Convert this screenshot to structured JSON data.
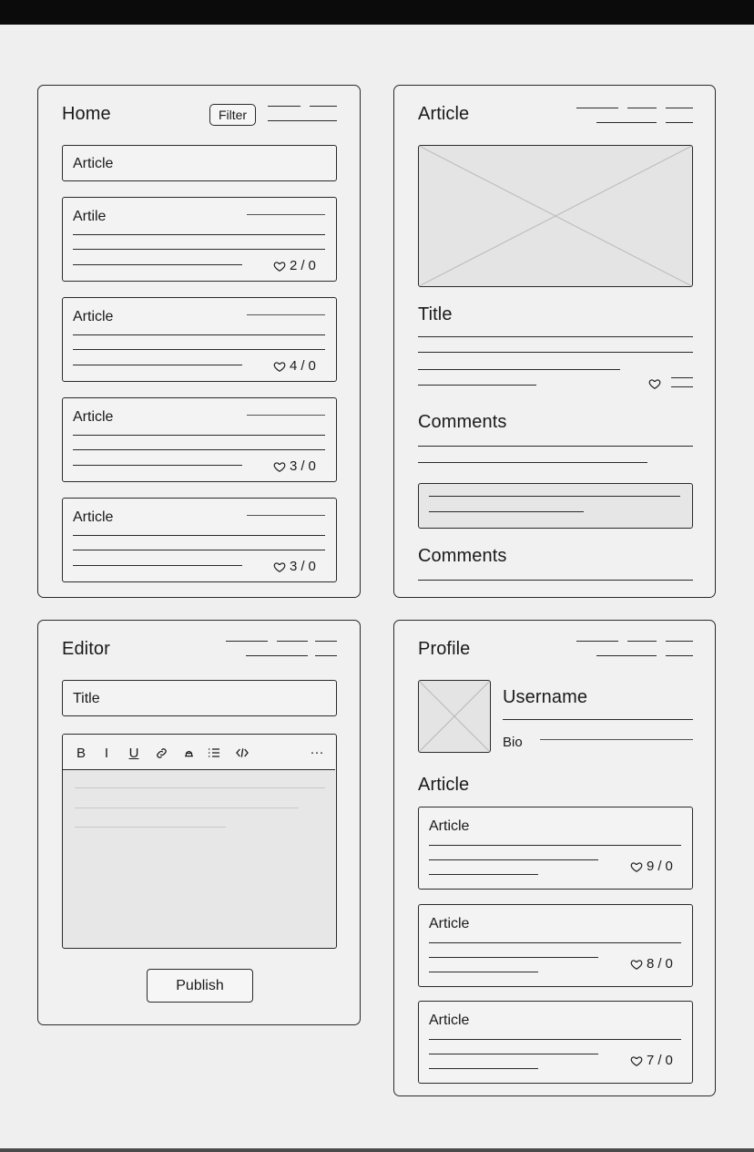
{
  "home": {
    "title": "Home",
    "filter_label": "Filter",
    "search_value": "Article",
    "articles": [
      {
        "title": "Artile",
        "likes": "2",
        "sep": "/",
        "comments": "0"
      },
      {
        "title": "Article",
        "likes": "4",
        "sep": "/",
        "comments": "0"
      },
      {
        "title": "Article",
        "likes": "3",
        "sep": "/",
        "comments": "0"
      },
      {
        "title": "Article",
        "likes": "3",
        "sep": "/",
        "comments": "0"
      }
    ]
  },
  "article": {
    "title": "Article",
    "heading": "Title",
    "comments_heading": "Comments",
    "comments_heading_2": "Comments"
  },
  "editor": {
    "title": "Editor",
    "title_field_value": "Title",
    "toolbar": {
      "bold": "B",
      "italic": "I",
      "underline": "U",
      "more": "···"
    },
    "publish_label": "Publish"
  },
  "profile": {
    "title": "Profile",
    "username": "Username",
    "bio_label": "Bio",
    "articles_heading": "Article",
    "articles": [
      {
        "title": "Article",
        "likes": "9",
        "sep": "/",
        "comments": "0"
      },
      {
        "title": "Article",
        "likes": "8",
        "sep": "/",
        "comments": "0"
      },
      {
        "title": "Article",
        "likes": "7",
        "sep": "/",
        "comments": "0"
      }
    ]
  },
  "icons": {
    "heart": "heart-icon",
    "menu": "menu-icon",
    "link": "link-icon",
    "highlight": "highlight-icon",
    "list": "bulleted-list-icon",
    "code": "code-icon",
    "image_placeholder": "image-placeholder-icon"
  },
  "colors": {
    "background": "#efefef",
    "stroke": "#2a2a2a",
    "placeholder_fill": "#e4e4e4",
    "topbar": "#0b0b0b"
  }
}
